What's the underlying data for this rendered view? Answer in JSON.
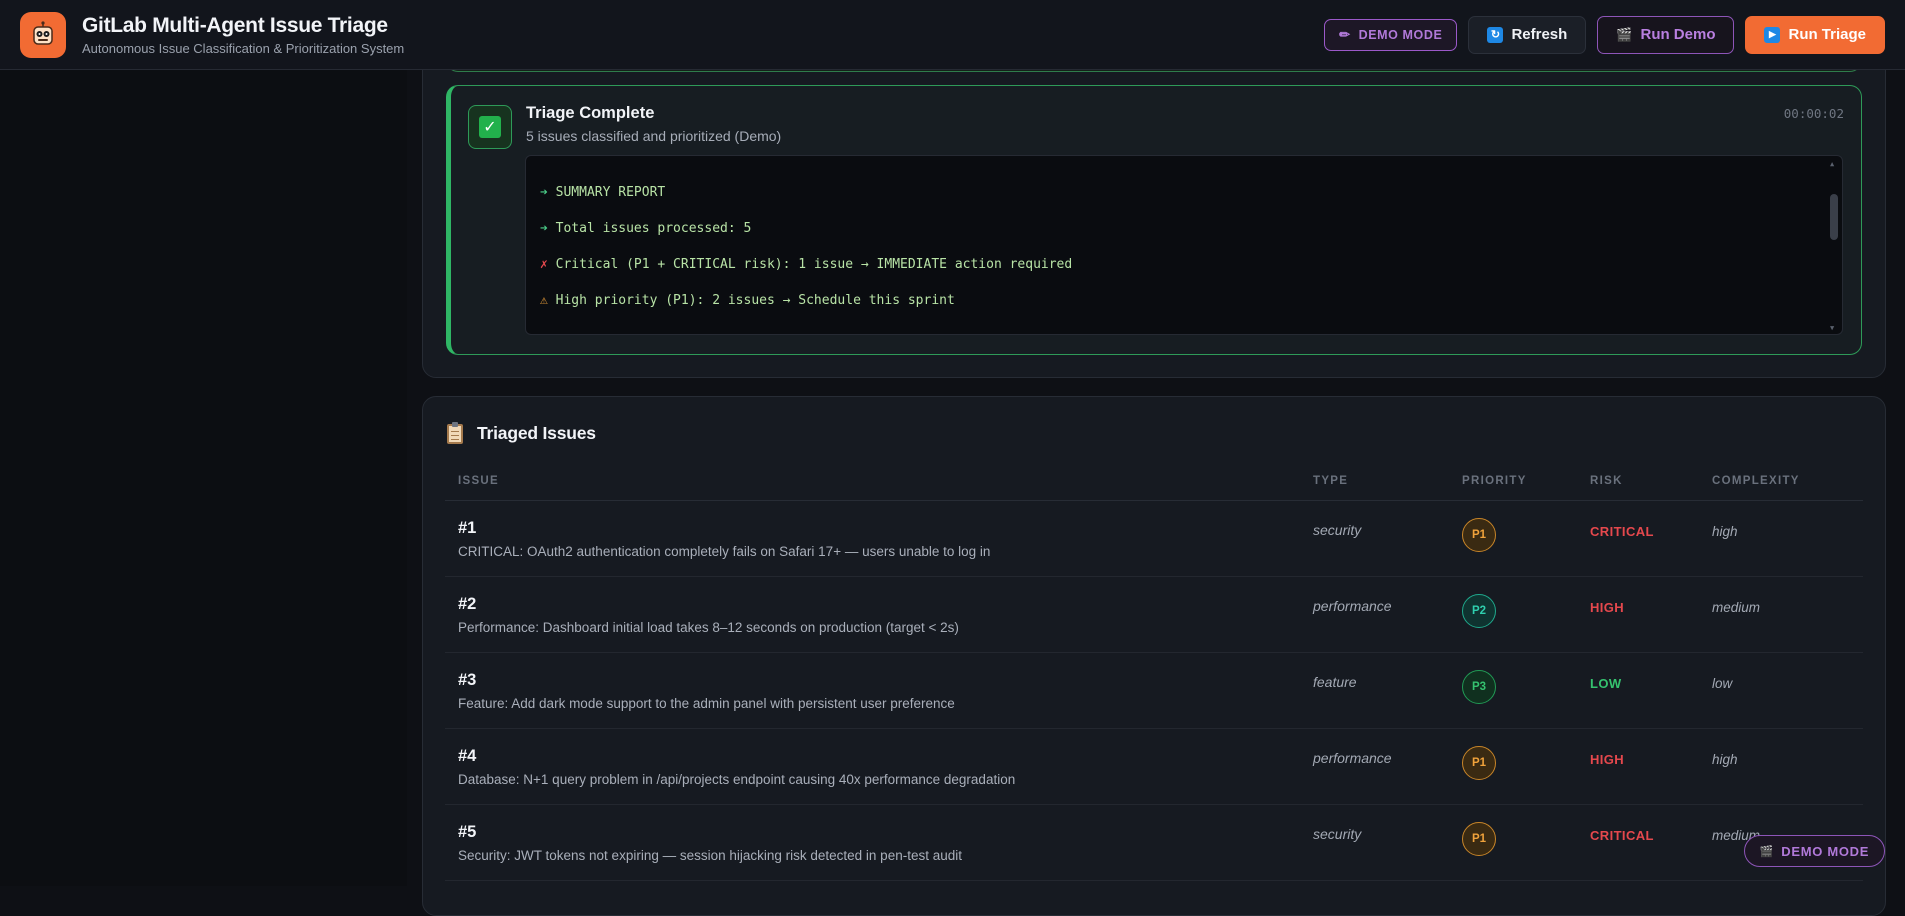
{
  "header": {
    "title": "GitLab Multi-Agent Issue Triage",
    "subtitle": "Autonomous Issue Classification & Prioritization System",
    "logo_icon": "robot-icon",
    "demo_mode_label": "DEMO MODE",
    "refresh_label": "Refresh",
    "run_demo_label": "Run Demo",
    "run_triage_label": "Run Triage",
    "accent_color": "#f26b33"
  },
  "progress": {
    "step_title": "Triage Complete",
    "step_description": "5 issues classified and prioritized (Demo)",
    "elapsed": "00:00:02",
    "console_lines": [
      {
        "icon": "➔",
        "text": " SUMMARY REPORT"
      },
      {
        "icon": "➔",
        "text": " Total issues processed: 5"
      },
      {
        "icon": "✗",
        "text": " Critical (P1 + CRITICAL risk): 1 issue → IMMEDIATE action required"
      },
      {
        "icon": "⚠",
        "text": " High priority (P1): 2 issues → Schedule this sprint"
      }
    ]
  },
  "issues": {
    "heading": "Triaged Issues",
    "columns": {
      "issue": "ISSUE",
      "type": "TYPE",
      "priority": "PRIORITY",
      "risk": "RISK",
      "complexity": "COMPLEXITY"
    },
    "rows": [
      {
        "number": "#1",
        "title": "CRITICAL: OAuth2 authentication completely fails on Safari 17+ — users unable to log in",
        "type": "security",
        "priority": "P1",
        "risk": "CRITICAL",
        "complexity": "high"
      },
      {
        "number": "#2",
        "title": "Performance: Dashboard initial load takes 8–12 seconds on production (target < 2s)",
        "type": "performance",
        "priority": "P2",
        "risk": "HIGH",
        "complexity": "medium"
      },
      {
        "number": "#3",
        "title": "Feature: Add dark mode support to the admin panel with persistent user preference",
        "type": "feature",
        "priority": "P3",
        "risk": "LOW",
        "complexity": "low"
      },
      {
        "number": "#4",
        "title": "Database: N+1 query problem in /api/projects endpoint causing 40x performance degradation",
        "type": "performance",
        "priority": "P1",
        "risk": "HIGH",
        "complexity": "high"
      },
      {
        "number": "#5",
        "title": "Security: JWT tokens not expiring — session hijacking risk detected in pen-test audit",
        "type": "security",
        "priority": "P1",
        "risk": "CRITICAL",
        "complexity": "medium"
      }
    ]
  },
  "floating_badge": {
    "label": "DEMO MODE"
  }
}
